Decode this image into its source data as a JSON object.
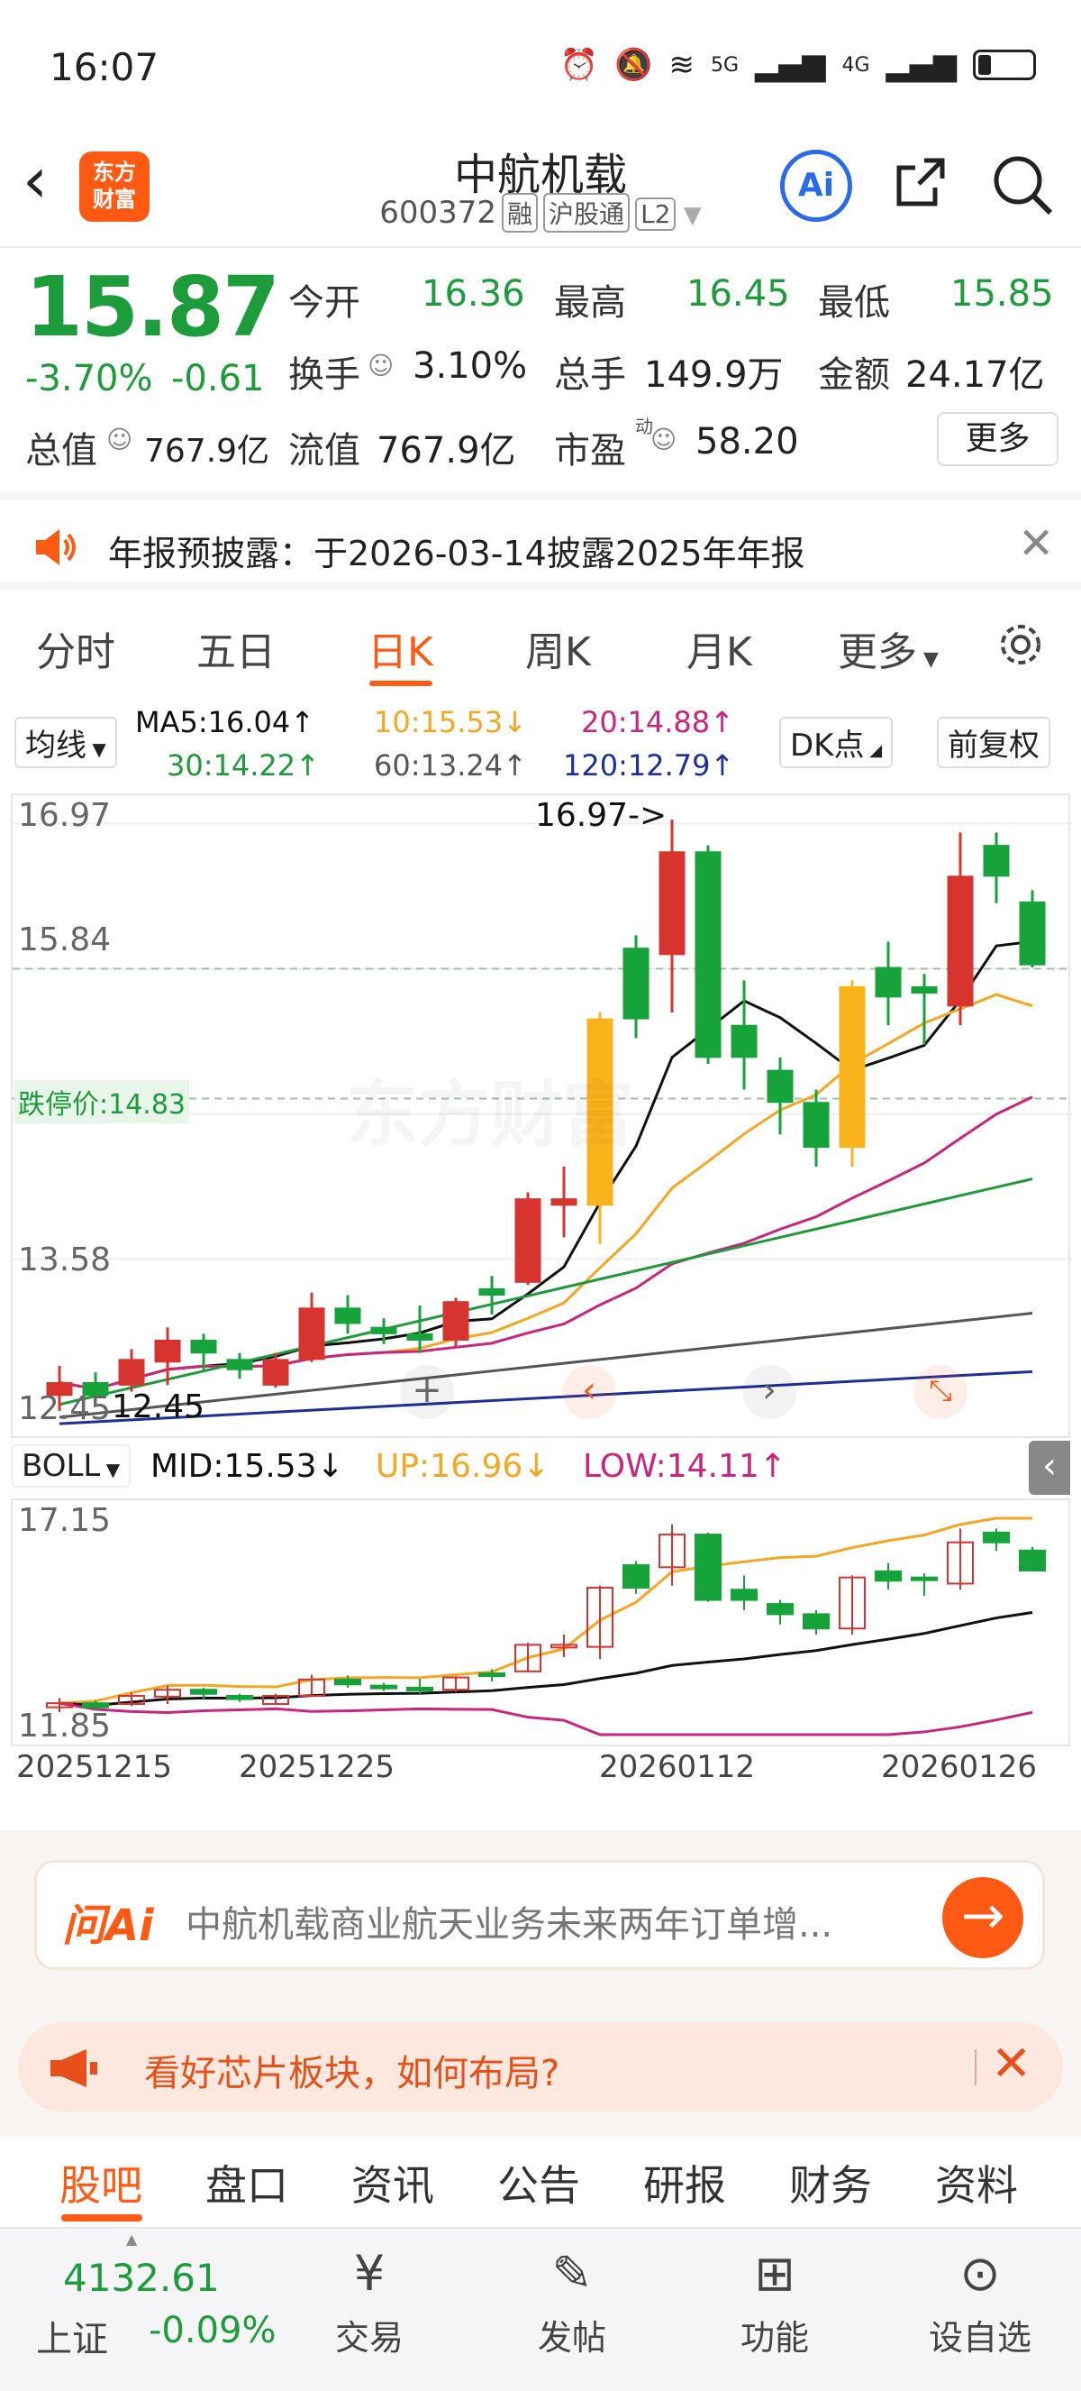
{
  "status_bar": {
    "time": "16:07",
    "net1": "5G",
    "net2": "4G"
  },
  "header": {
    "title": "中航机载",
    "code": "600372",
    "tag1": "融",
    "tag2": "沪股通",
    "tag3": "L2",
    "logo_line1": "东方",
    "logo_line2": "财富",
    "ai": "Ai"
  },
  "quote": {
    "price": "15.87",
    "pct": "-3.70%",
    "change": "-0.61",
    "open_label": "今开",
    "open": "16.36",
    "high_label": "最高",
    "high": "16.45",
    "low_label": "最低",
    "low": "15.85",
    "turnover_label": "换手",
    "turnover": "3.10%",
    "volume_label": "总手",
    "volume": "149.9万",
    "amount_label": "金额",
    "amount": "24.17亿",
    "mcap_label": "总值",
    "mcap": "767.9亿",
    "float_label": "流值",
    "float_cap": "767.9亿",
    "pe_label": "市盈",
    "pe_sup": "动",
    "pe": "58.20",
    "more": "更多"
  },
  "notice": {
    "text": "年报预披露：于2026-03-14披露2025年年报"
  },
  "tabs": [
    "分时",
    "五日",
    "日K",
    "周K",
    "月K",
    "更多"
  ],
  "indicators": {
    "ma_select": "均线",
    "ma5": "MA5:16.04↑",
    "ma10": "10:15.53↓",
    "ma20": "20:14.88↑",
    "ma30": "30:14.22↑",
    "ma60": "60:13.24↑",
    "ma120": "120:12.79↑",
    "dk": "DK点",
    "adjust": "前复权"
  },
  "kchart": {
    "y_top": "16.97",
    "y_mid": "15.84",
    "y_low": "13.58",
    "y_bot": "12.45",
    "max_label": "16.97->",
    "min_label": "12.45",
    "limit_down": "跌停价:14.83",
    "watermark": "东方财富",
    "colors": {
      "up": "#d8342f",
      "down": "#15a33a",
      "ma5": "#111111",
      "ma10": "#f5a623",
      "ma20": "#c8267e",
      "ma30": "#1f9a3a",
      "ma60": "#555555",
      "ma120": "#1e2f9a"
    }
  },
  "boll": {
    "select": "BOLL",
    "mid": "MID:15.53↓",
    "up": "UP:16.96↓",
    "low": "LOW:14.11↑",
    "y_top": "17.15",
    "y_bot": "11.85"
  },
  "dates": [
    "20251215",
    "20251225",
    "20260112",
    "20260126"
  ],
  "ask": {
    "brand": "问Ai",
    "question": "中航机载商业航天业务未来两年订单增..."
  },
  "promo": {
    "text": "看好芯片板块，如何布局?"
  },
  "bottom_tabs": [
    "股吧",
    "盘口",
    "资讯",
    "公告",
    "研报",
    "财务",
    "资料"
  ],
  "nav": {
    "index_value": "4132.61",
    "index_name": "上证",
    "index_pct": "-0.09%",
    "items": [
      "交易",
      "发帖",
      "功能",
      "设自选"
    ]
  },
  "chart_data": {
    "type": "candlestick",
    "candles": [
      {
        "o": 12.52,
        "c": 12.62,
        "h": 12.75,
        "l": 12.4
      },
      {
        "o": 12.62,
        "c": 12.52,
        "h": 12.7,
        "l": 12.45
      },
      {
        "o": 12.6,
        "c": 12.8,
        "h": 12.88,
        "l": 12.55
      },
      {
        "o": 12.78,
        "c": 12.95,
        "h": 13.05,
        "l": 12.6
      },
      {
        "o": 12.95,
        "c": 12.85,
        "h": 13.0,
        "l": 12.72
      },
      {
        "o": 12.8,
        "c": 12.72,
        "h": 12.85,
        "l": 12.65
      },
      {
        "o": 12.6,
        "c": 12.8,
        "h": 12.85,
        "l": 12.58
      },
      {
        "o": 12.8,
        "c": 13.2,
        "h": 13.32,
        "l": 12.78
      },
      {
        "o": 13.2,
        "c": 13.08,
        "h": 13.3,
        "l": 13.0
      },
      {
        "o": 13.05,
        "c": 13.0,
        "h": 13.12,
        "l": 12.92
      },
      {
        "o": 13.0,
        "c": 12.95,
        "h": 13.22,
        "l": 12.85
      },
      {
        "o": 12.95,
        "c": 13.25,
        "h": 13.28,
        "l": 12.9
      },
      {
        "o": 13.35,
        "c": 13.3,
        "h": 13.45,
        "l": 13.15
      },
      {
        "o": 13.4,
        "c": 14.05,
        "h": 14.1,
        "l": 13.38
      },
      {
        "o": 14.0,
        "c": 14.05,
        "h": 14.3,
        "l": 13.75
      },
      {
        "o": 14.0,
        "c": 15.45,
        "h": 15.5,
        "l": 13.7
      },
      {
        "o": 16.0,
        "c": 15.45,
        "h": 16.1,
        "l": 15.3
      },
      {
        "o": 15.95,
        "c": 16.75,
        "h": 17.0,
        "l": 15.5
      },
      {
        "o": 16.75,
        "c": 15.15,
        "h": 16.8,
        "l": 15.1
      },
      {
        "o": 15.4,
        "c": 15.15,
        "h": 15.75,
        "l": 14.9
      },
      {
        "o": 15.05,
        "c": 14.8,
        "h": 15.15,
        "l": 14.55
      },
      {
        "o": 14.8,
        "c": 14.45,
        "h": 14.9,
        "l": 14.3
      },
      {
        "o": 14.45,
        "c": 15.7,
        "h": 15.75,
        "l": 14.3
      },
      {
        "o": 15.85,
        "c": 15.62,
        "h": 16.05,
        "l": 15.4
      },
      {
        "o": 15.7,
        "c": 15.65,
        "h": 15.8,
        "l": 15.25
      },
      {
        "o": 15.55,
        "c": 16.56,
        "h": 16.9,
        "l": 15.4
      },
      {
        "o": 16.8,
        "c": 16.56,
        "h": 16.9,
        "l": 16.35
      },
      {
        "o": 16.36,
        "c": 15.87,
        "h": 16.45,
        "l": 15.85
      }
    ]
  }
}
